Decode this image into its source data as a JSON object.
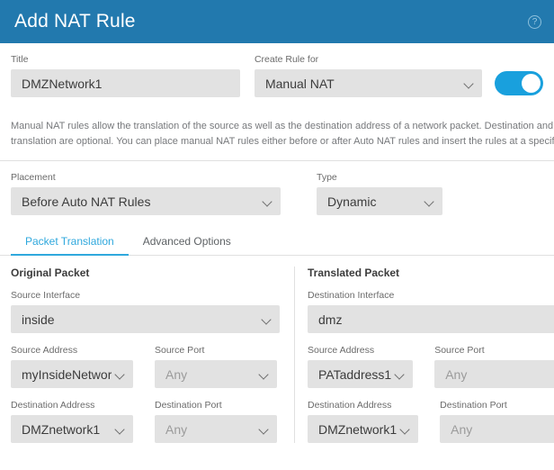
{
  "header": {
    "title": "Add NAT Rule",
    "help_icon": "question-circle-icon",
    "background": "#2279ae"
  },
  "top_form": {
    "title_label": "Title",
    "title_value": "DMZNetwork1",
    "create_rule_for_label": "Create Rule for",
    "create_rule_for_value": "Manual NAT",
    "enable_toggle_state": "on",
    "toggle_color": "#19a0dd"
  },
  "description": {
    "line1": "Manual NAT rules allow the translation of the source as well as the destination address of a network packet. Destination and port",
    "line2": "translation are optional. You can place manual NAT rules either before or after Auto NAT rules and insert the rules at a specific location."
  },
  "placement_form": {
    "placement_label": "Placement",
    "placement_value": "Before Auto NAT Rules",
    "type_label": "Type",
    "type_value": "Dynamic"
  },
  "tabs": [
    {
      "label": "Packet Translation",
      "active": true
    },
    {
      "label": "Advanced Options",
      "active": false
    }
  ],
  "tab_accent": "#2fa8dd",
  "original_packet": {
    "title": "Original Packet",
    "source_interface_label": "Source Interface",
    "source_interface_value": "inside",
    "source_address_label": "Source Address",
    "source_address_value": "myInsideNetwork",
    "source_port_label": "Source Port",
    "source_port_value": "Any",
    "destination_address_label": "Destination Address",
    "destination_address_value": "DMZnetwork1",
    "destination_port_label": "Destination Port",
    "destination_port_value": "Any"
  },
  "translated_packet": {
    "title": "Translated Packet",
    "destination_interface_label": "Destination Interface",
    "destination_interface_value": "dmz",
    "source_address_label": "Source Address",
    "source_address_value": "PATaddress1",
    "source_port_label": "Source Port",
    "source_port_value": "Any",
    "destination_address_label": "Destination Address",
    "destination_address_value": "DMZnetwork1",
    "destination_port_label": "Destination Port",
    "destination_port_value": "Any"
  }
}
